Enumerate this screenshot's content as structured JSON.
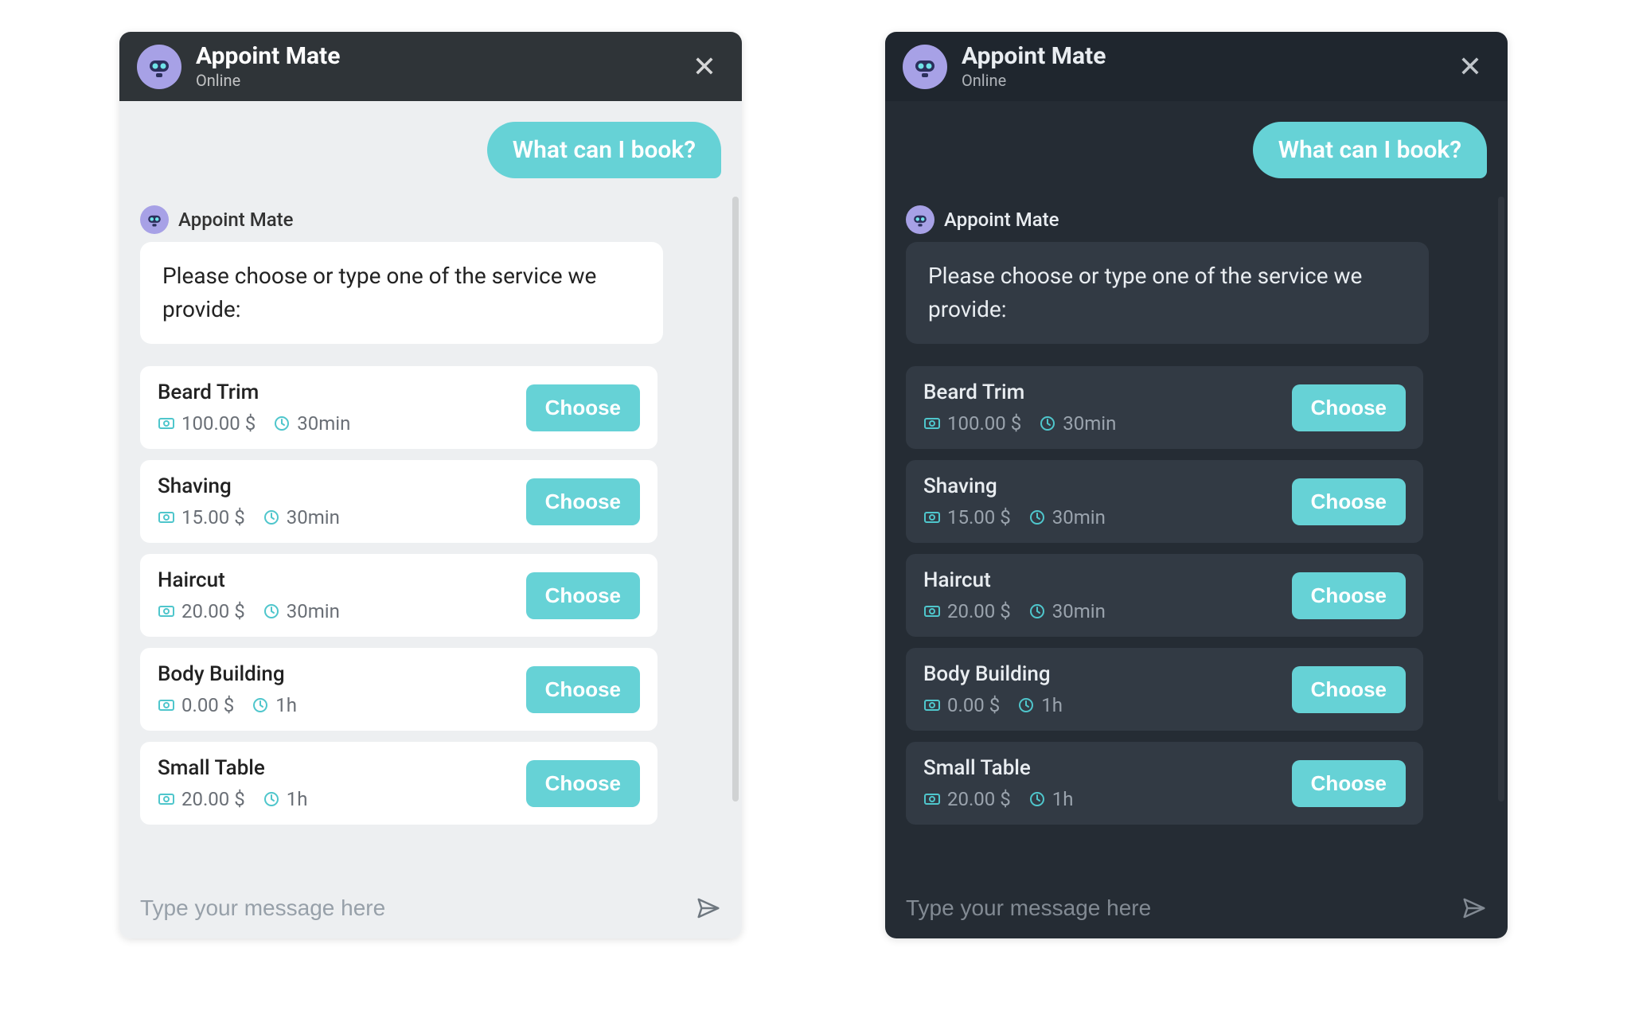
{
  "accent_color": "#66d2d6",
  "header": {
    "title": "Appoint Mate",
    "status": "Online"
  },
  "user_message": "What can I book?",
  "bot_name": "Appoint Mate",
  "bot_message": "Please choose or type one of the service we provide:",
  "choose_label": "Choose",
  "input_placeholder": "Type your message here",
  "services": [
    {
      "name": "Beard Trim",
      "price": "100.00 $",
      "duration": "30min"
    },
    {
      "name": "Shaving",
      "price": "15.00 $",
      "duration": "30min"
    },
    {
      "name": "Haircut",
      "price": "20.00 $",
      "duration": "30min"
    },
    {
      "name": "Body Building",
      "price": "0.00 $",
      "duration": "1h"
    },
    {
      "name": "Small Table",
      "price": "20.00 $",
      "duration": "1h"
    }
  ]
}
